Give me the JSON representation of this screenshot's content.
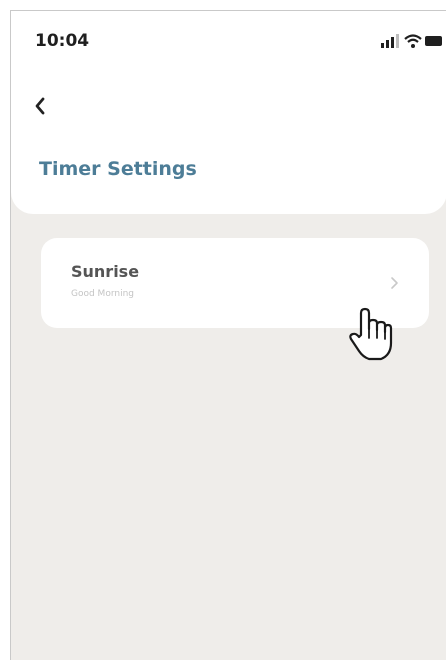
{
  "status_bar": {
    "time": "10:04"
  },
  "nav": {
    "back_icon": "chevron-left-icon"
  },
  "page": {
    "title": "Timer Settings"
  },
  "items": [
    {
      "title": "Sunrise",
      "subtitle": "Good Morning",
      "icon": "chevron-right-icon"
    }
  ],
  "colors": {
    "title": "#4d7d97",
    "background": "#efedea",
    "card": "#ffffff"
  }
}
